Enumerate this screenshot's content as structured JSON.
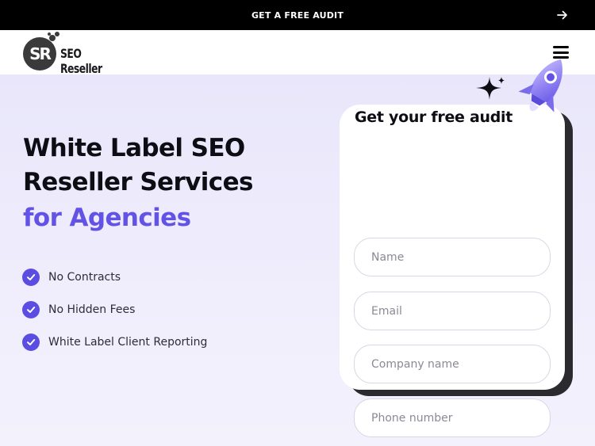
{
  "banner": {
    "text": "GET A FREE AUDIT",
    "arrow_icon": "arrow-right-icon"
  },
  "header": {
    "logo_mark": "SR",
    "logo_text": "SEO Reseller",
    "menu_icon": "hamburger-menu-icon"
  },
  "hero": {
    "title_line1": "White Label SEO",
    "title_line2": "Reseller Services",
    "title_line3": "for Agencies",
    "features": [
      {
        "label": "No Contracts"
      },
      {
        "label": "No Hidden Fees"
      },
      {
        "label": "White Label Client Reporting"
      }
    ]
  },
  "form": {
    "title": "Get your free audit",
    "fields": [
      {
        "placeholder": "Name"
      },
      {
        "placeholder": "Email"
      },
      {
        "placeholder": "Company name"
      },
      {
        "placeholder": "Phone number"
      }
    ]
  },
  "colors": {
    "accent": "#6253e6",
    "check": "#5b4de2",
    "banner_bg": "#000000",
    "hero_bg": "#eeebfb"
  }
}
